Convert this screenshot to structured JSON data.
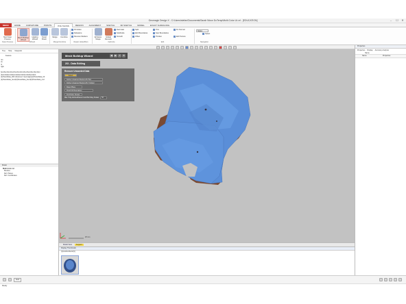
{
  "window": {
    "title": "Geomagic Design X - C:\\Users\\stefan\\Documents\\Sarah Nixon DoTemp\\Multi-Color Lit.xrl - [EDUCATION]",
    "minimize": "–",
    "maximize": "☐",
    "close": "✕"
  },
  "menu": {
    "file": "MENU",
    "tabs": [
      "HOME",
      "CURVATURE",
      "POINTS",
      "POLYGONS",
      "REGION",
      "ALIGNMENT",
      "SKETCH",
      "3D SKETCH",
      "MODEL",
      "EXACT SURFACING"
    ],
    "active_tab": "POLYGONS"
  },
  "ribbon": {
    "big_buttons": [
      "Start Scan Process",
      "Mesh Buildup Wizard",
      "Healing Wizard",
      "Smart Brush",
      "Merge",
      "Combine",
      "Triangulate"
    ],
    "fill_holes": "Fill Holes",
    "defeature": "Defeature",
    "remove_markers": "Remove Markers",
    "enhance_shape": "Enhance Shape",
    "global_remesh": "Global Remesh",
    "decimate": "Decimate",
    "subdivide": "Subdivide",
    "smooth": "Smooth",
    "split": "Split",
    "edit_boundaries": "Edit Boundaries",
    "offset": "Offset",
    "trim": "Trim",
    "sew_boundaries": "Sew Boundaries",
    "thicken": "Thicken",
    "fix_normal": "Fix Normal",
    "edit_texture": "Edit Texture",
    "select_mode": "Select",
    "mode_value": "Nodes",
    "groups": {
      "scan_process": "Scan Process",
      "wizard": "Wizard",
      "merge_combine": "Merge/Combine",
      "repair_holes": "Repair Holes/Bors",
      "optimize": "Optimize",
      "edit": "Edit",
      "navigation": "Navigation"
    }
  },
  "left_panel": {
    "tabs": [
      "Tree",
      "Help",
      "Viewpoint"
    ],
    "feature_header": "Feature",
    "lines": [
      "res",
      "os",
      "nt",
      "ngle"
    ],
    "log_text": [
      "[\\end\\end\\end\\end\\end\\end\\end\\end\\end\\end\\end\\en",
      "(2)\\end(2)\\end(2)\\end(2)\\end(2)\\end(2)\\end(2)\\",
      "(2)\\ScanData_000 (Scanned: Geomagic)(2)\\ScanData_00",
      "(2)\\ScanData_3end(2)\\ScanData_3end(2)\\ScanData_end"
    ],
    "model_header": "Model",
    "tree": [
      "Multi-Color Lit",
      "Meshes",
      "Ref. Planes",
      "Ref. Coordinates"
    ]
  },
  "wizard": {
    "title": "Mesh Buildup Wizard",
    "step": "2/3 - Data Editing",
    "section": "Remove Unwanted Data",
    "select_button": "Select",
    "btn_define_box": "Define Unwanted Regions By Box",
    "btn_define_cylinder": "Define Unwanted Regions By Cylinder",
    "btn_reset_plane": "Reset Plane",
    "btn_flood_fill": "Flood Fill Boundaries",
    "btn_find_noisy": "Find Noisy Cluster",
    "max_label": "Max. Poly-Vertices/Faces Could Be Noisy Cluster",
    "max_value": "50"
  },
  "viewport": {
    "scale_label": "25 mm"
  },
  "view_tabs": [
    "Model View",
    "Support"
  ],
  "thumb_panel": {
    "title": "Display Thumbnails",
    "item": "(1)\\end\\end\\end(1)"
  },
  "right_panel": {
    "title": "Properties",
    "tabs": [
      "Properties",
      "Display",
      "Accuracy Analyzer"
    ],
    "name_label": "Name",
    "col_name": "Name",
    "col_properties": "Properties"
  },
  "bottom_bar": {
    "left_items": [
      "Ready",
      "Auto"
    ],
    "status": "Ready"
  }
}
